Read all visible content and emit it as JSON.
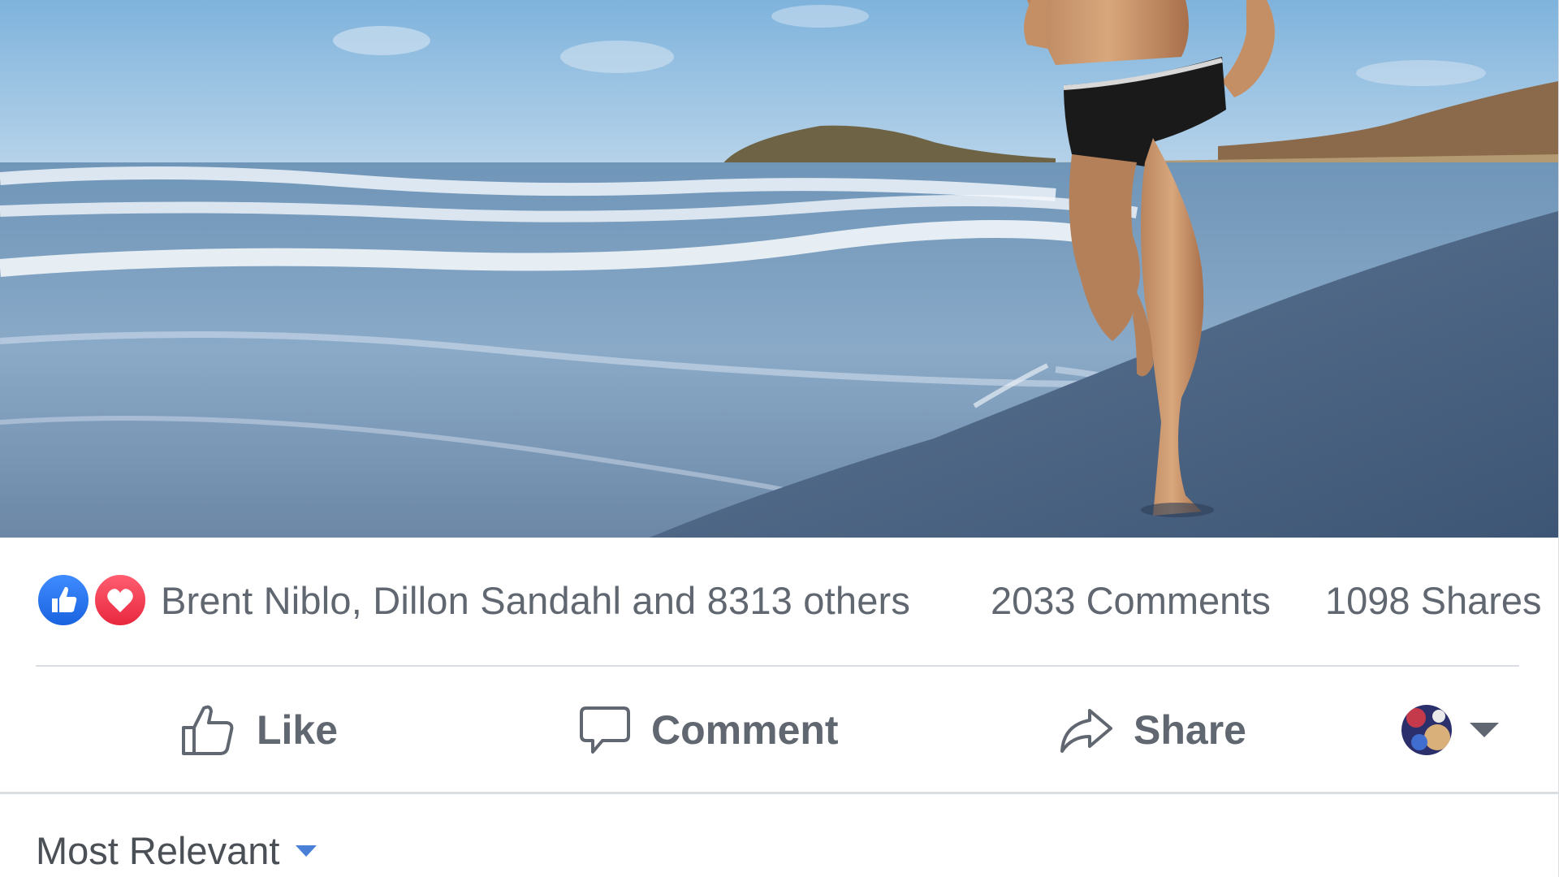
{
  "post": {
    "photo_alt": "beach-runner-photo",
    "reactions": {
      "icons": [
        "like-reaction-icon",
        "love-reaction-icon"
      ],
      "names_text": "Brent Niblo, Dillon Sandahl and 8313 others",
      "comments_text": "2033 Comments",
      "shares_text": "1098 Shares"
    },
    "actions": {
      "like_label": "Like",
      "comment_label": "Comment",
      "share_label": "Share"
    },
    "comments": {
      "sort_label": "Most Relevant"
    }
  },
  "colors": {
    "like_blue": "#1a63e0",
    "love_red": "#e8283f",
    "text_gray": "#606770",
    "divider": "#dadde1",
    "sort_caret": "#4a7fd8"
  }
}
